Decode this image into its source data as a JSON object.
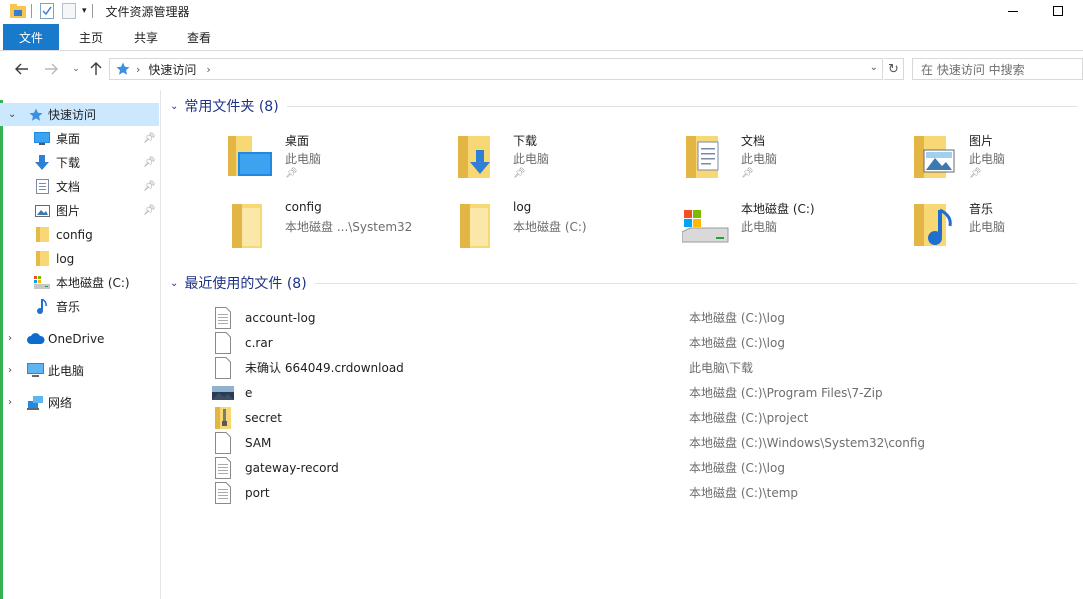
{
  "window": {
    "title": "文件资源管理器",
    "minimize": "—",
    "maximize": "☐"
  },
  "ribbon": {
    "tabs": [
      "文件",
      "主页",
      "共享",
      "查看"
    ]
  },
  "address": {
    "location": "快速访问",
    "search_placeholder": "在 快速访问 中搜索"
  },
  "nav": {
    "quick_access": "快速访问",
    "items": [
      "桌面",
      "下载",
      "文档",
      "图片",
      "config",
      "log",
      "本地磁盘 (C:)",
      "音乐"
    ],
    "onedrive": "OneDrive",
    "this_pc": "此电脑",
    "network": "网络"
  },
  "frequent": {
    "header": "常用文件夹 (8)",
    "tiles": [
      {
        "name": "桌面",
        "sub": "此电脑",
        "icon": "desktop-folder-icon",
        "pinned": true
      },
      {
        "name": "下载",
        "sub": "此电脑",
        "icon": "downloads-folder-icon",
        "pinned": true
      },
      {
        "name": "文档",
        "sub": "此电脑",
        "icon": "documents-folder-icon",
        "pinned": true
      },
      {
        "name": "图片",
        "sub": "此电脑",
        "icon": "pictures-folder-icon",
        "pinned": true
      },
      {
        "name": "config",
        "sub": "本地磁盘 ...\\System32",
        "icon": "folder-icon",
        "pinned": false
      },
      {
        "name": "log",
        "sub": "本地磁盘 (C:)",
        "icon": "folder-icon",
        "pinned": false
      },
      {
        "name": "本地磁盘 (C:)",
        "sub": "此电脑",
        "icon": "drive-icon",
        "pinned": false
      },
      {
        "name": "音乐",
        "sub": "此电脑",
        "icon": "music-folder-icon",
        "pinned": false
      }
    ]
  },
  "recent": {
    "header": "最近使用的文件 (8)",
    "files": [
      {
        "name": "account-log",
        "path": "本地磁盘 (C:)\\log",
        "icon": "file-icon"
      },
      {
        "name": "c.rar",
        "path": "本地磁盘 (C:)\\log",
        "icon": "file-icon"
      },
      {
        "name": "未确认 664049.crdownload",
        "path": "此电脑\\下载",
        "icon": "file-icon"
      },
      {
        "name": "e",
        "path": "本地磁盘 (C:)\\Program Files\\7-Zip",
        "icon": "image-file-icon"
      },
      {
        "name": "secret",
        "path": "本地磁盘 (C:)\\project",
        "icon": "zip-folder-icon"
      },
      {
        "name": "SAM",
        "path": "本地磁盘 (C:)\\Windows\\System32\\config",
        "icon": "file-icon"
      },
      {
        "name": "gateway-record",
        "path": "本地磁盘 (C:)\\log",
        "icon": "file-icon"
      },
      {
        "name": "port",
        "path": "本地磁盘 (C:)\\temp",
        "icon": "file-icon"
      }
    ]
  },
  "colors": {
    "accent": "#1979ca",
    "selection": "#cce8ff",
    "group_header": "#1e3287",
    "folder": "#f8d775"
  }
}
